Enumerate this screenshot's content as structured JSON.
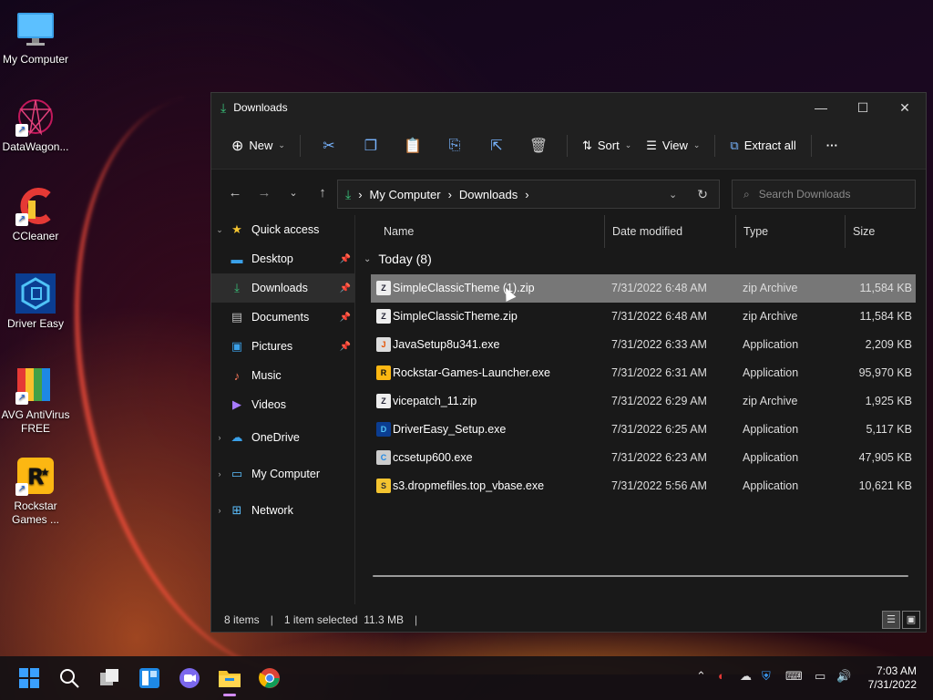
{
  "desktop": {
    "icons": [
      {
        "label": "My Computer"
      },
      {
        "label": "DataWagon..."
      },
      {
        "label": "CCleaner"
      },
      {
        "label": "Driver Easy"
      },
      {
        "label": "AVG AntiVirus FREE"
      },
      {
        "label": "Rockstar Games ..."
      }
    ]
  },
  "window": {
    "title": "Downloads",
    "controls": {
      "minimize": "—",
      "maximize": "☐",
      "close": "✕"
    }
  },
  "toolbar": {
    "new_label": "New",
    "sort_label": "Sort",
    "view_label": "View",
    "extract_label": "Extract all",
    "more_label": "···"
  },
  "address": {
    "crumbs": [
      "My Computer",
      "Downloads"
    ],
    "separator": "›"
  },
  "search": {
    "placeholder": "Search Downloads"
  },
  "sidebar": {
    "quick_access": "Quick access",
    "items": [
      {
        "label": "Desktop"
      },
      {
        "label": "Downloads"
      },
      {
        "label": "Documents"
      },
      {
        "label": "Pictures"
      },
      {
        "label": "Music"
      },
      {
        "label": "Videos"
      }
    ],
    "onedrive": "OneDrive",
    "mycomputer": "My Computer",
    "network": "Network"
  },
  "columns": {
    "name": "Name",
    "date": "Date modified",
    "type": "Type",
    "size": "Size"
  },
  "group": {
    "label": "Today (8)"
  },
  "files": [
    {
      "name": "SimpleClassicTheme (1).zip",
      "date": "7/31/2022 6:48 AM",
      "type": "zip Archive",
      "size": "11,584 KB"
    },
    {
      "name": "SimpleClassicTheme.zip",
      "date": "7/31/2022 6:48 AM",
      "type": "zip Archive",
      "size": "11,584 KB"
    },
    {
      "name": "JavaSetup8u341.exe",
      "date": "7/31/2022 6:33 AM",
      "type": "Application",
      "size": "2,209 KB"
    },
    {
      "name": "Rockstar-Games-Launcher.exe",
      "date": "7/31/2022 6:31 AM",
      "type": "Application",
      "size": "95,970 KB"
    },
    {
      "name": "vicepatch_11.zip",
      "date": "7/31/2022 6:29 AM",
      "type": "zip Archive",
      "size": "1,925 KB"
    },
    {
      "name": "DriverEasy_Setup.exe",
      "date": "7/31/2022 6:25 AM",
      "type": "Application",
      "size": "5,117 KB"
    },
    {
      "name": "ccsetup600.exe",
      "date": "7/31/2022 6:23 AM",
      "type": "Application",
      "size": "47,905 KB"
    },
    {
      "name": "s3.dropmefiles.top_vbase.exe",
      "date": "7/31/2022 5:56 AM",
      "type": "Application",
      "size": "10,621 KB"
    }
  ],
  "status": {
    "count": "8 items",
    "selection": "1 item selected  11.3 MB"
  },
  "clock": {
    "time": "7:03 AM",
    "date": "7/31/2022"
  }
}
